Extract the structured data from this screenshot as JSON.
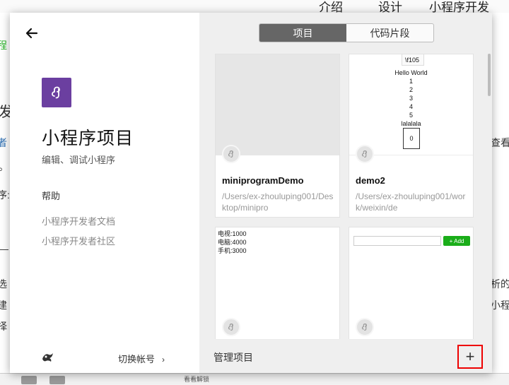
{
  "background": {
    "nav": [
      "介绍",
      "设计",
      "小程序开发"
    ],
    "left_fragments": [
      "程",
      "发",
      "者",
      "。",
      "序:",
      "—",
      "选",
      "建",
      "择"
    ],
    "right_fragments": [
      "查看",
      "析的",
      "小程"
    ],
    "bottom_text": "看看解锁"
  },
  "left_panel": {
    "back_icon": "back-arrow-icon",
    "logo_icon": "miniprogram-logo-icon",
    "title": "小程序项目",
    "subtitle": "编辑、调试小程序",
    "help_heading": "帮助",
    "help_links": [
      "小程序开发者文档",
      "小程序开发者社区"
    ],
    "switch_account": "切换帐号"
  },
  "tabs": [
    {
      "label": "项目",
      "active": true
    },
    {
      "label": "代码片段",
      "active": false
    }
  ],
  "projects": [
    {
      "name": "miniprogramDemo",
      "path": "/Users/ex-zhouluping001/Desktop/minipro"
    },
    {
      "name": "demo2",
      "path": "/Users/ex-zhouluping001/work/weixin/de"
    }
  ],
  "previews": {
    "demo2": {
      "code": "\\f105",
      "lines": [
        "Hello World",
        "1",
        "2",
        "3",
        "4",
        "5",
        "lalalala"
      ],
      "box": "0"
    },
    "list": [
      "电视:1000",
      "电脑:4000",
      "手机:3000"
    ],
    "add_label": "+ Add"
  },
  "footer": {
    "manage_label": "管理项目",
    "add_symbol": "+"
  },
  "colors": {
    "logo_bg": "#6b3fa0",
    "add_highlight": "#e00000",
    "add_button_green": "#1aad19"
  }
}
